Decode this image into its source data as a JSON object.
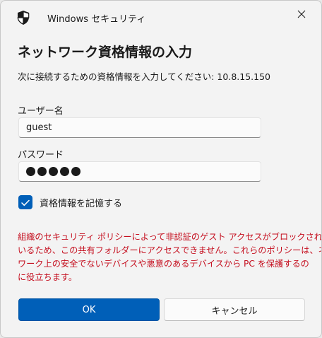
{
  "window": {
    "app_title": "Windows セキュリティ",
    "close_icon": "close-icon",
    "app_icon": "shield-icon"
  },
  "dialog": {
    "heading": "ネットワーク資格情報の入力",
    "instruction": "次に接続するための資格情報を入力してください: 10.8.15.150",
    "username_label": "ユーザー名",
    "username_value": "guest",
    "password_label": "パスワード",
    "password_length": 5,
    "remember_label": "資格情報を記憶する",
    "remember_checked": true,
    "warning_lines": [
      "組織のセキュリティ ポリシーによって非認証のゲスト アクセスがブロックされて",
      "いるため、この共有フォルダーにアクセスできません。これらのポリシーは、ネット",
      "ワーク上の安全でないデバイスや悪意のあるデバイスから PC を保護するの",
      "に役立ちます。"
    ],
    "ok_label": "OK",
    "cancel_label": "キャンセル"
  },
  "colors": {
    "accent": "#005fb8",
    "warning": "#c50f1f",
    "background": "#f3f3f3"
  }
}
